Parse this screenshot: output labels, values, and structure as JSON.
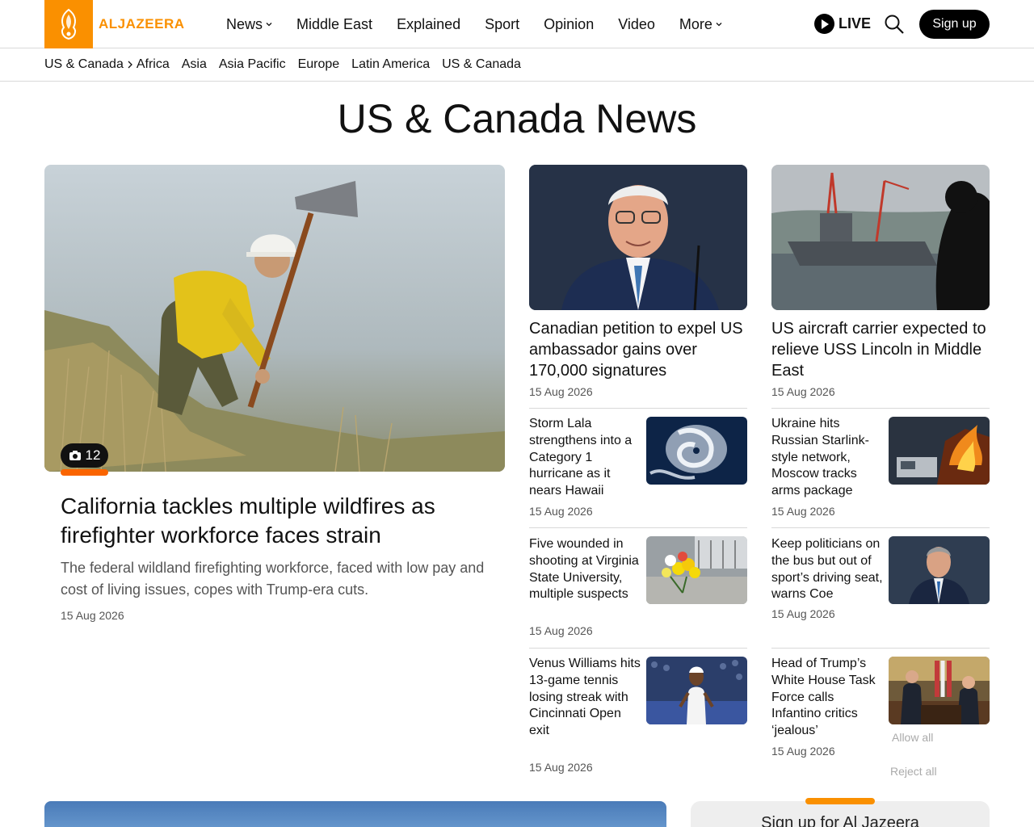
{
  "brand": {
    "name": "ALJAZEERA",
    "accent": "#fa9000"
  },
  "nav": {
    "items": [
      {
        "label": "News",
        "has_dropdown": true
      },
      {
        "label": "Middle East",
        "has_dropdown": false
      },
      {
        "label": "Explained",
        "has_dropdown": false
      },
      {
        "label": "Sport",
        "has_dropdown": false
      },
      {
        "label": "Opinion",
        "has_dropdown": false
      },
      {
        "label": "Video",
        "has_dropdown": false
      },
      {
        "label": "More",
        "has_dropdown": true
      }
    ],
    "live_label": "LIVE",
    "signup_label": "Sign up"
  },
  "subnav": {
    "current": "US & Canada",
    "items": [
      "Africa",
      "Asia",
      "Asia Pacific",
      "Europe",
      "Latin America",
      "US & Canada"
    ]
  },
  "page_title": "US & Canada News",
  "hero": {
    "photo_count": "12",
    "title": "California tackles multiple wildfires as firefighter workforce faces strain",
    "description": "The federal wildland firefighting workforce, faced with low pay and cost of living issues, copes with Trump-era cuts.",
    "date": "15 Aug 2026"
  },
  "top_cards": [
    {
      "title": "Canadian petition to expel US ambassador gains over 170,000 signatures",
      "date": "15 Aug 2026"
    },
    {
      "title": "US aircraft carrier expected to relieve USS Lincoln in Middle East",
      "date": "15 Aug 2026"
    }
  ],
  "small_stories": [
    {
      "title": "Storm Lala strengthens into a Category 1 hurricane as it nears Hawaii",
      "date": "15 Aug 2026"
    },
    {
      "title": "Ukraine hits Russian Starlink-style network, Moscow tracks arms package",
      "date": "15 Aug 2026"
    },
    {
      "title": "Five wounded in shooting at Virginia State University, multiple suspects",
      "date": "15 Aug 2026"
    },
    {
      "title": "Keep politicians on the bus but out of sport’s driving seat, warns Coe",
      "date": "15 Aug 2026"
    },
    {
      "title": "Venus Williams hits 13-game tennis losing streak with Cincinnati Open exit",
      "date": "15 Aug 2026"
    },
    {
      "title": "Head of Trump’s White House Task Force calls Infantino critics ‘jealous’",
      "date": "15 Aug 2026"
    }
  ],
  "cookie": {
    "allow_all": "Allow all",
    "reject_all": "Reject all"
  },
  "newsletter": {
    "title": "Sign up for Al Jazeera"
  }
}
